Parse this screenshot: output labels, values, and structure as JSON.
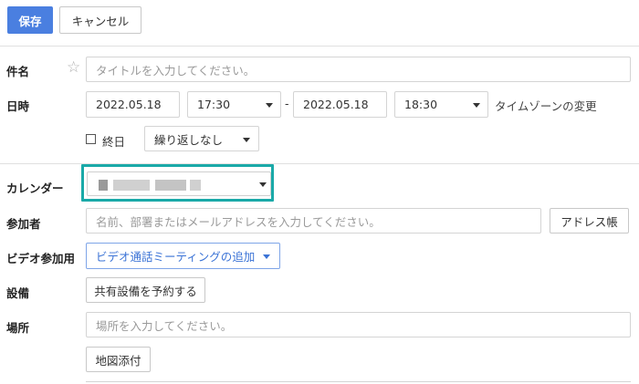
{
  "toolbar": {
    "save_label": "保存",
    "cancel_label": "キャンセル"
  },
  "form": {
    "subject": {
      "label": "件名",
      "placeholder": "タイトルを入力してください。"
    },
    "datetime": {
      "label": "日時",
      "start_date": "2022.05.18",
      "start_time": "17:30",
      "separator": "-",
      "end_date": "2022.05.18",
      "end_time": "18:30",
      "timezone_link": "タイムゾーンの変更",
      "all_day_label": "終日",
      "repeat_value": "繰り返しなし"
    },
    "calendar": {
      "label": "カレンダー"
    },
    "participants": {
      "label": "参加者",
      "placeholder": "名前、部署またはメールアドレスを入力してください。",
      "address_book_label": "アドレス帳"
    },
    "video": {
      "label": "ビデオ参加用",
      "button_label": "ビデオ通話ミーティングの追加"
    },
    "equipment": {
      "label": "設備",
      "button_label": "共有設備を予約する"
    },
    "location": {
      "label": "場所",
      "placeholder": "場所を入力してください。",
      "map_button_label": "地図添付"
    }
  },
  "colors": {
    "primary": "#4a7fe0",
    "highlight": "#1aa9a8",
    "link": "#3b73d6"
  }
}
